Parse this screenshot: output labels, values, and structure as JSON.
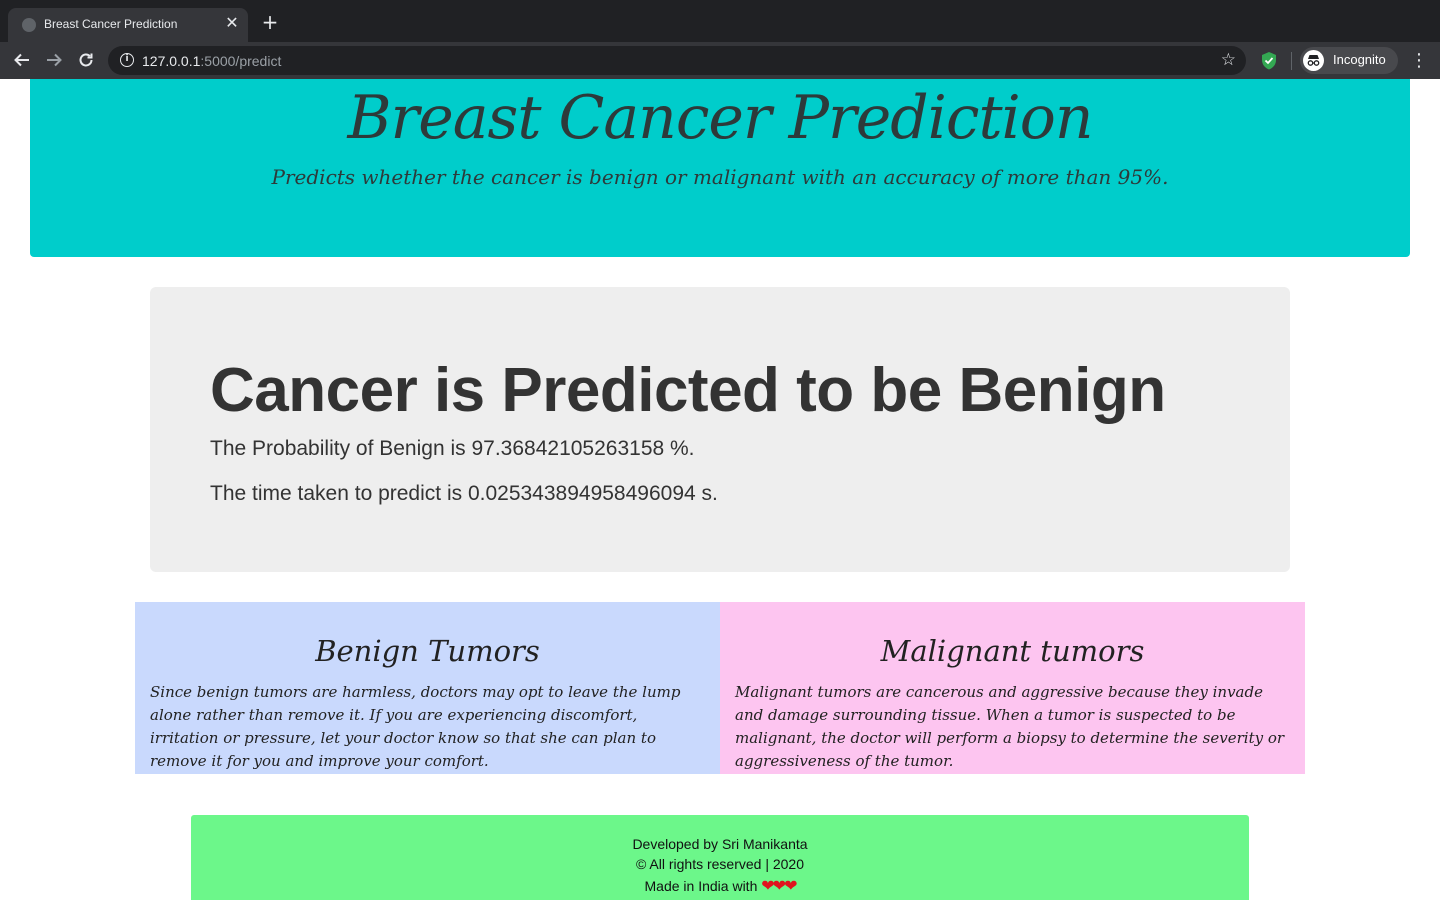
{
  "browser": {
    "tab_title": "Breast Cancer Prediction",
    "tab_close": "✕",
    "new_tab": "+",
    "url_host": "127.0.0.1",
    "url_rest": ":5000/predict",
    "profile_label": "Incognito"
  },
  "header": {
    "title": "Breast Cancer Prediction",
    "subtitle": "Predicts whether the cancer is benign or malignant with an accuracy of more than 95%."
  },
  "result": {
    "heading": "Cancer is Predicted to be Benign",
    "probability_text": "The Probability of Benign is 97.36842105263158 %.",
    "time_text": "The time taken to predict is 0.025343894958496094 s."
  },
  "info": {
    "benign": {
      "title": "Benign Tumors",
      "text": "Since benign tumors are harmless, doctors may opt to leave the lump alone rather than remove it. If you are experiencing discomfort, irritation or pressure, let your doctor know so that she can plan to remove it for you and improve your comfort."
    },
    "malignant": {
      "title": "Malignant tumors",
      "text": "Malignant tumors are cancerous and aggressive because they invade and damage surrounding tissue. When a tumor is suspected to be malignant, the doctor will perform a biopsy to determine the severity or aggressiveness of the tumor."
    }
  },
  "footer": {
    "developed_by": "Developed by Sri Manikanta",
    "rights": "© All rights reserved | 2020",
    "made_in": "Made in India with",
    "hearts": "❤❤❤"
  },
  "colors": {
    "hero_bg": "#00cdcb",
    "result_bg": "#eeeeee",
    "benign_bg": "#c9d9fd",
    "malignant_bg": "#fdc5f0",
    "footer_bg": "#6cf78a"
  }
}
